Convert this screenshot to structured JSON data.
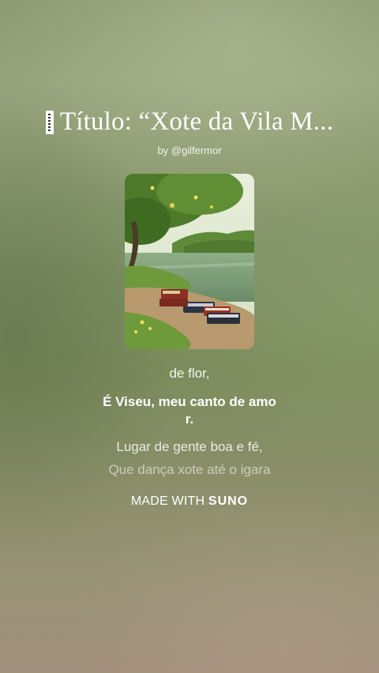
{
  "song": {
    "title": "Título: “Xote da Vila M...",
    "byline": "by @gilfermor"
  },
  "lyrics": {
    "previous": "de flor,",
    "current_line1": "É Viseu, meu canto de amo",
    "current_line2": "r.",
    "next": "Lugar de gente boa e fé,",
    "upcoming": "Que dança xote até o igara"
  },
  "footer": {
    "made_with": "MADE WITH",
    "brand": "SUNO"
  },
  "cover_art": {
    "icon": "cover-image-icon",
    "description_colors": {
      "sky": "#e6ecd8",
      "water": "#7fa07a",
      "grass": "#6f9a3c",
      "path": "#b89a6e"
    }
  }
}
